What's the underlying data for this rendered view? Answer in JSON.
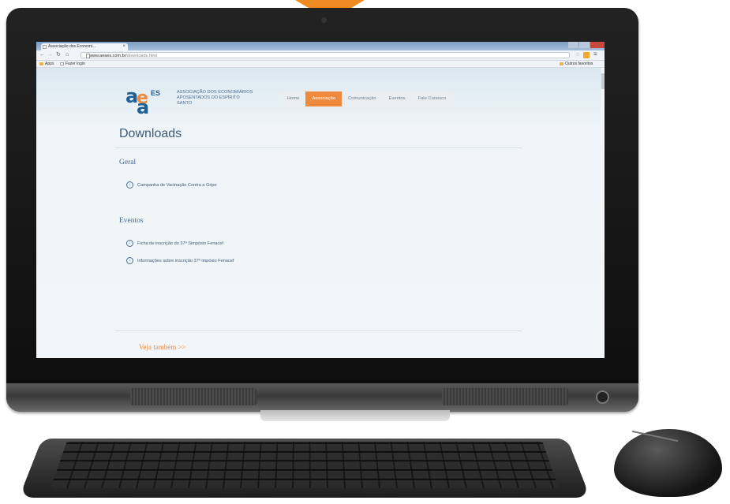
{
  "browser": {
    "tab_title": "Associação dos Economi...",
    "tab_close": "×",
    "url_host": "www.aeaes.com.br",
    "url_path": "/downloads.html",
    "bookmarks": {
      "apps": "Apps",
      "login": "Fazer login",
      "other": "Outros favoritos"
    }
  },
  "site": {
    "logo_letters": "aea",
    "logo_suffix": "ES",
    "org_line1": "ASSOCIAÇÃO DOS ECONOMIÁRIOS",
    "org_line2": "APOSENTADOS DO ESPÍRITO SANTO",
    "nav": [
      {
        "label": "Home"
      },
      {
        "label": "Associação"
      },
      {
        "label": "Comunicação"
      },
      {
        "label": "Eventos"
      },
      {
        "label": "Fale Conosco"
      }
    ],
    "active_nav_index": 1
  },
  "page": {
    "title": "Downloads",
    "sections": [
      {
        "title": "Geral",
        "items": [
          "Campanha de Vacinação Contra a Gripe"
        ]
      },
      {
        "title": "Eventos",
        "items": [
          "Ficha de inscrição do 37º Simpósio Fenacef",
          "Informações sobre inscrição 37º impósio Fenacef"
        ]
      }
    ],
    "see_also": "Veja também >>"
  },
  "colors": {
    "accent": "#ef8a3c",
    "brand_blue": "#1f5f96",
    "text": "#3e5a77"
  }
}
